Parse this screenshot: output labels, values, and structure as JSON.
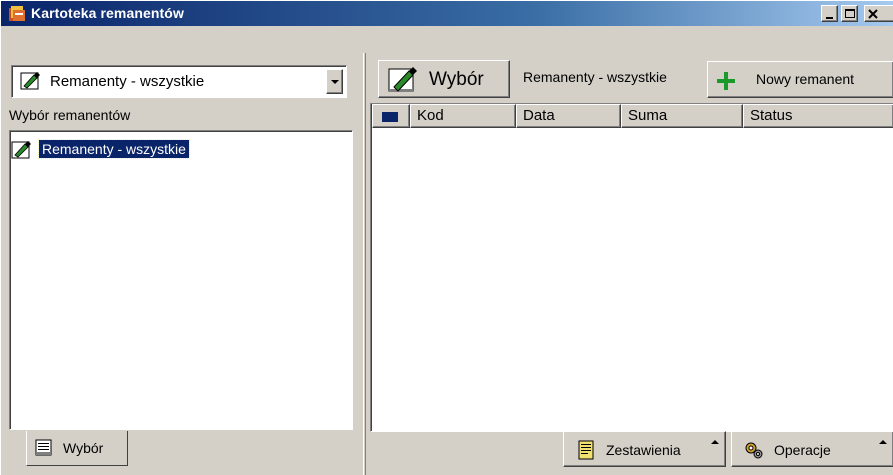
{
  "window": {
    "title": "Kartoteka remanentów",
    "icon": "inventory-app-icon"
  },
  "left_panel": {
    "combo_value": "Remanenty - wszystkie",
    "section_label": "Wybór remanentów",
    "tree_items": [
      {
        "label": "Remanenty - wszystkie",
        "selected": true
      }
    ],
    "tab_label": "Wybór"
  },
  "toolbar": {
    "wybor_label": "Wybór",
    "breadcrumb": "Remanenty - wszystkie",
    "new_button_label": "Nowy remanent"
  },
  "list": {
    "columns": [
      "Kod",
      "Data",
      "Suma",
      "Status"
    ],
    "rows": []
  },
  "bottom_bar": {
    "zestawienia_label": "Zestawienia",
    "operacje_label": "Operacje"
  },
  "colors": {
    "titlebar_start": "#0a246a",
    "titlebar_end": "#a6caf0",
    "selection": "#0a246a",
    "face": "#d4d0c8",
    "plus_icon": "#1a9a2a"
  }
}
